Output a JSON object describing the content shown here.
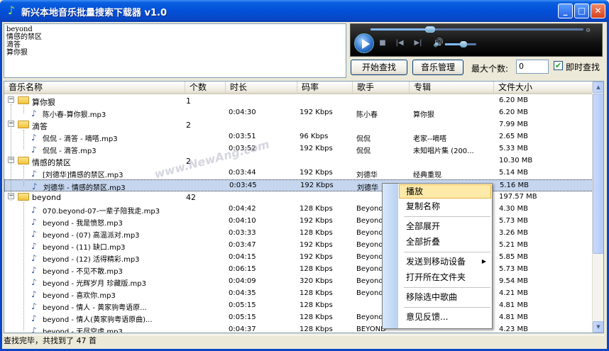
{
  "window": {
    "title": "新兴本地音乐批量搜索下载器 v1.0",
    "minimize": "_",
    "maximize": "□",
    "close": "✕"
  },
  "query_text": [
    "beyond",
    "情感的禁区",
    "滴答",
    "算你狠"
  ],
  "toolbar": {
    "search_button": "开始查找",
    "manage_button": "音乐管理",
    "max_label": "最大个数:",
    "max_value": "0",
    "instant_label": "即时查找",
    "instant_checked": true
  },
  "player": {
    "seek_progress": 0.28,
    "volume": 0.6,
    "icons": [
      "play-icon",
      "stop-icon",
      "previous-icon",
      "next-icon",
      "volume-icon"
    ]
  },
  "columns": [
    "音乐名称",
    "个数",
    "时长",
    "码率",
    "歌手",
    "专辑",
    "文件大小"
  ],
  "rows": [
    {
      "type": "group",
      "name": "算你狠",
      "count": "1",
      "size": "6.20 MB"
    },
    {
      "type": "song",
      "name": "陈小春-算你狠.mp3",
      "duration": "0:04:30",
      "bitrate": "192 Kbps",
      "artist": "陈小春",
      "album": "算你狠",
      "size": "6.20 MB"
    },
    {
      "type": "group",
      "name": "滴答",
      "count": "2",
      "size": "7.99 MB"
    },
    {
      "type": "song",
      "name": "侃侃 - 滴答 - 嘀嗒.mp3",
      "duration": "0:03:51",
      "bitrate": "96 Kbps",
      "artist": "侃侃",
      "album": "老家--嘀嗒",
      "size": "2.65 MB"
    },
    {
      "type": "song",
      "name": "侃侃 - 滴答.mp3",
      "duration": "0:03:52",
      "bitrate": "192 Kbps",
      "artist": "侃侃",
      "album": "未知唱片集 (200...",
      "size": "5.33 MB"
    },
    {
      "type": "group",
      "name": "情感的禁区",
      "count": "2",
      "size": "10.30 MB"
    },
    {
      "type": "song",
      "name": "[刘德华]情感的禁区.mp3",
      "duration": "0:03:44",
      "bitrate": "192 Kbps",
      "artist": "刘德华",
      "album": "经典重现",
      "size": "5.14 MB"
    },
    {
      "type": "song",
      "selected": true,
      "name": "刘德华 - 情感的禁区.mp3",
      "duration": "0:03:45",
      "bitrate": "192 Kbps",
      "artist": "刘德华",
      "album": "",
      "size": "5.16 MB"
    },
    {
      "type": "group",
      "name": "beyond",
      "count": "42",
      "size": "197.57 MB"
    },
    {
      "type": "song",
      "name": "070.beyond-07-一辈子陪我走.mp3",
      "duration": "0:04:42",
      "bitrate": "128 Kbps",
      "artist": "Beyond",
      "album": "",
      "size": "4.30 MB"
    },
    {
      "type": "song",
      "name": "beyond -  我是愤怒.mp3",
      "duration": "0:04:10",
      "bitrate": "192 Kbps",
      "artist": "Beyond",
      "album": "",
      "size": "5.73 MB"
    },
    {
      "type": "song",
      "name": "beyond - (07) 高温派对.mp3",
      "duration": "0:03:33",
      "bitrate": "128 Kbps",
      "artist": "Beyond",
      "album": "",
      "size": "3.26 MB"
    },
    {
      "type": "song",
      "name": "beyond - (11)  缺口.mp3",
      "duration": "0:03:47",
      "bitrate": "192 Kbps",
      "artist": "Beyond",
      "album": "",
      "size": "5.21 MB"
    },
    {
      "type": "song",
      "name": "beyond - (12)  活得精彩.mp3",
      "duration": "0:04:15",
      "bitrate": "192 Kbps",
      "artist": "Beyond",
      "album": "",
      "size": "5.85 MB"
    },
    {
      "type": "song",
      "name": "beyond - 不见不散.mp3",
      "duration": "0:06:15",
      "bitrate": "128 Kbps",
      "artist": "Beyond",
      "album": "",
      "size": "5.73 MB"
    },
    {
      "type": "song",
      "name": "beyond - 光辉岁月 珍藏版.mp3",
      "duration": "0:04:09",
      "bitrate": "320 Kbps",
      "artist": "Beyond",
      "album": "",
      "size": "9.54 MB"
    },
    {
      "type": "song",
      "name": "beyond - 喜欢你.mp3",
      "duration": "0:04:35",
      "bitrate": "128 Kbps",
      "artist": "Beyond",
      "album": "",
      "size": "4.21 MB"
    },
    {
      "type": "song",
      "name": "beyond - 情人 - 黄家驹粤语原...",
      "duration": "0:05:15",
      "bitrate": "128 Kbps",
      "artist": "",
      "album": "",
      "size": "4.81 MB"
    },
    {
      "type": "song",
      "name": "beyond - 情人(黄家驹粤语原曲)...",
      "duration": "0:05:15",
      "bitrate": "128 Kbps",
      "artist": "Beyond",
      "album": "",
      "size": "4.81 MB"
    },
    {
      "type": "song",
      "name": "beyond - 无尽空虚.mp3",
      "duration": "0:04:37",
      "bitrate": "128 Kbps",
      "artist": "BEYOND",
      "album": "",
      "size": "4.23 MB"
    }
  ],
  "context_menu": {
    "items": [
      "播放",
      "复制名称",
      "全部展开",
      "全部折叠",
      "发送到移动设备",
      "打开所在文件夹",
      "移除选中歌曲",
      "意见反馈..."
    ],
    "highlighted": "播放"
  },
  "watermark": "www.NewAng.com",
  "status": "查找完毕，共找到了 47 首"
}
